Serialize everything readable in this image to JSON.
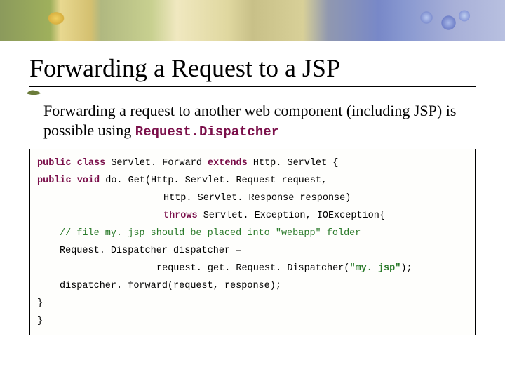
{
  "slide": {
    "title": "Forwarding a Request to a JSP",
    "intro_part1": "Forwarding a request to another web component (including JSP) is possible using ",
    "intro_code": "Request.Dispatcher"
  },
  "code": {
    "l1_kw1": "public class",
    "l1_txt1": " Servlet. Forward ",
    "l1_kw2": "extends",
    "l1_txt2": " Http. Servlet {",
    "l2_kw1": "public void",
    "l2_txt1": " do. Get(Http. Servlet. Request request,",
    "l3_txt": "Http. Servlet. Response response)",
    "l4_kw": "throws",
    "l4_txt": " Servlet. Exception, IOException{",
    "l5_cm": "// file my. jsp should be placed into \"webapp\" folder",
    "l6_txt": "Request. Dispatcher dispatcher =",
    "l7_txt1": "request. get. Request. Dispatcher(",
    "l7_str": "\"my. jsp\"",
    "l7_txt2": ");",
    "l8_txt": "dispatcher. forward(request, response);",
    "l9": "}",
    "l10": "}"
  }
}
